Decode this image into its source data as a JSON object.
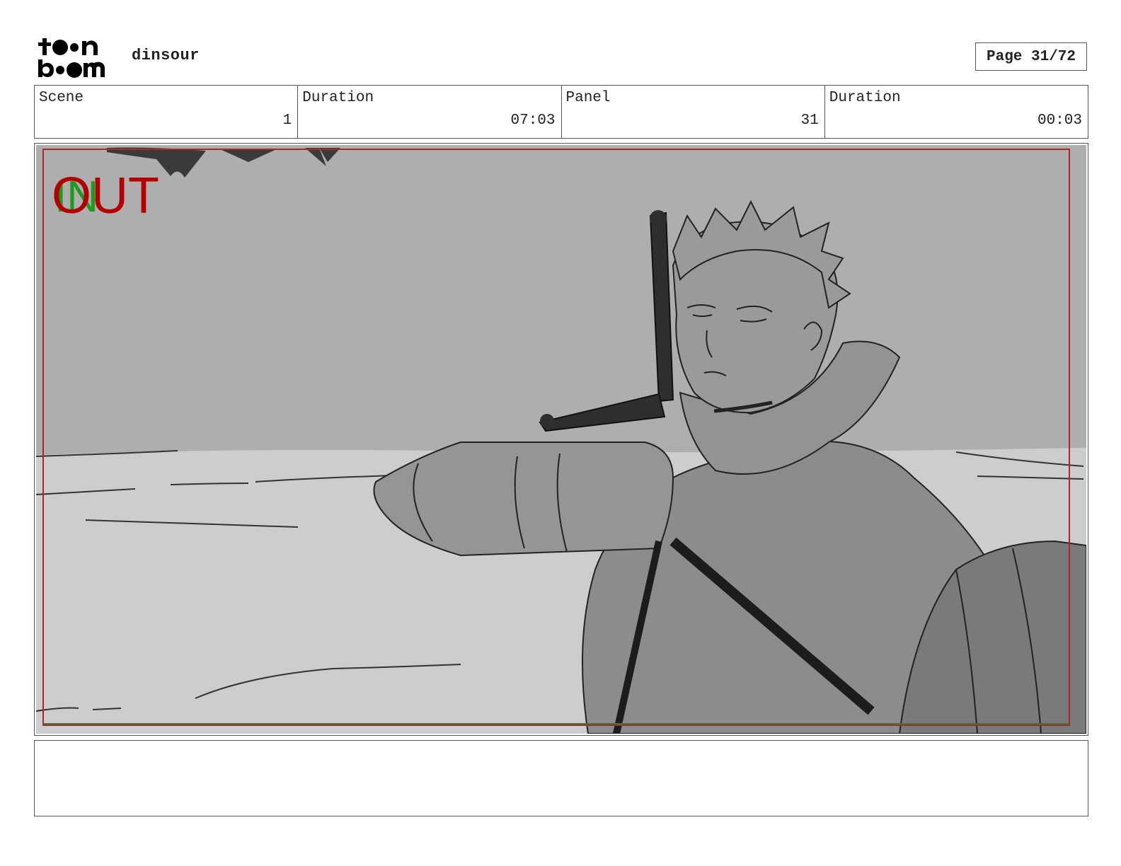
{
  "header": {
    "logo_alt": "toon boom",
    "project_name": "dinsour",
    "page_label": "Page 31/72"
  },
  "info": [
    {
      "label": "Scene",
      "value": "1"
    },
    {
      "label": "Duration",
      "value": "07:03"
    },
    {
      "label": "Panel",
      "value": "31"
    },
    {
      "label": "Duration",
      "value": "00:03"
    }
  ],
  "panel": {
    "in_marker": "IN",
    "out_marker": "OUT",
    "colors": {
      "in_marker": "#1f9a1f",
      "out_marker": "#b30000",
      "safe_frame": "#a52a2a",
      "sky": "#aeaeae",
      "ground": "#cdcdcd",
      "figure": "#8c8c8c"
    }
  },
  "notes": {
    "text": ""
  }
}
